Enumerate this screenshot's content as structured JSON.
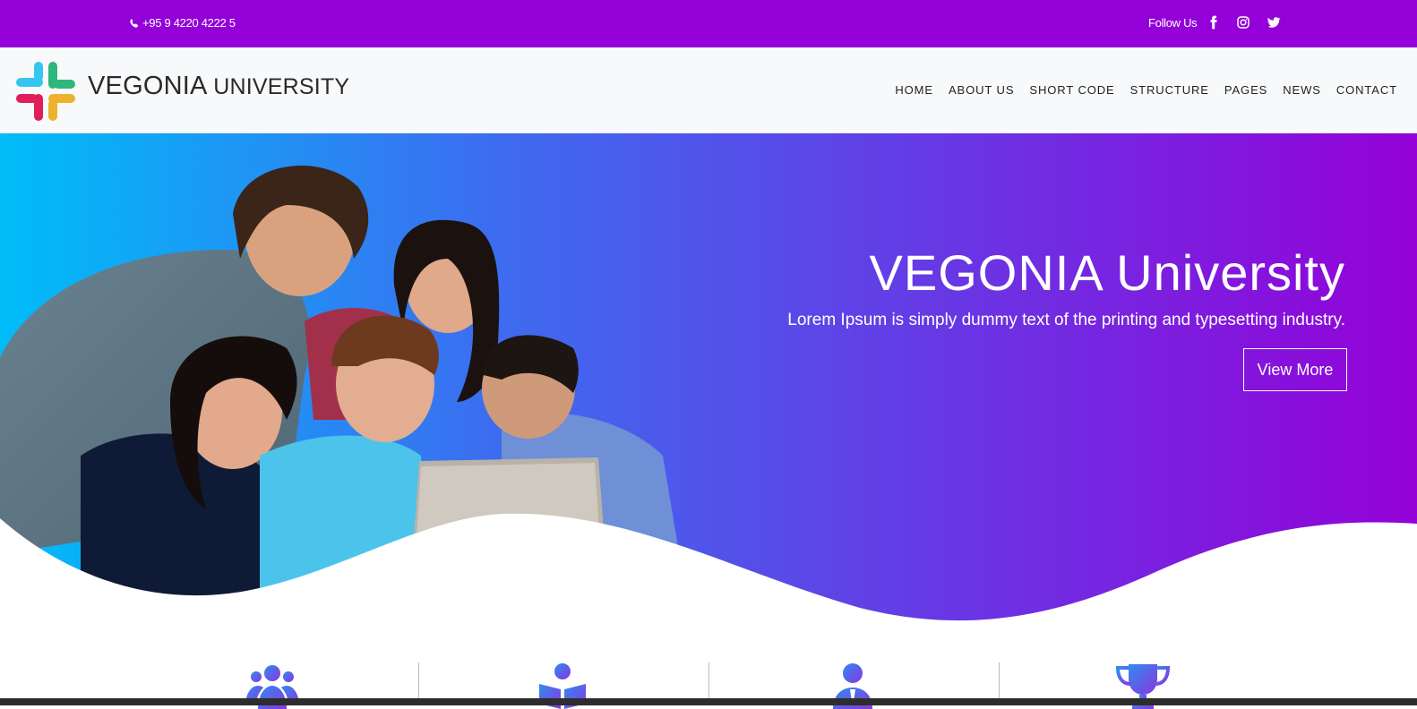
{
  "topbar": {
    "phone": "+95 9 4220 4222 5",
    "follow_label": "Follow Us",
    "social_icons": [
      "facebook-icon",
      "instagram-icon",
      "twitter-icon"
    ]
  },
  "brand": {
    "name_part1": "VEGONIA",
    "name_part2": "UNIVERSITY"
  },
  "nav": {
    "items": [
      "HOME",
      "ABOUT US",
      "SHORT CODE",
      "STRUCTURE",
      "PAGES",
      "NEWS",
      "CONTACT"
    ]
  },
  "hero": {
    "title": "VEGONIA University",
    "subtitle": "Lorem Ipsum is simply dummy text of the printing and typesetting industry.",
    "button": "View More",
    "gradient_start": "#00bdf8",
    "gradient_end": "#9401d8"
  },
  "features": {
    "icons": [
      "users-icon",
      "book-reader-icon",
      "teacher-icon",
      "trophy-icon"
    ]
  },
  "colors": {
    "topbar": "#9401d8",
    "navbar": "#f8f9fa"
  }
}
